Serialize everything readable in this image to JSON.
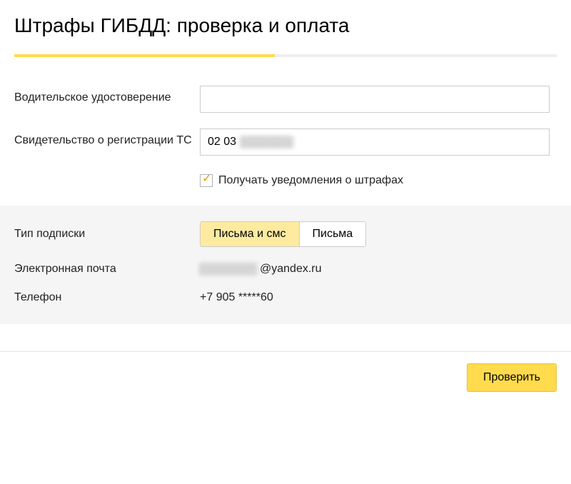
{
  "title": "Штрафы ГИБДД: проверка и оплата",
  "fields": {
    "driver_license": {
      "label": "Водительское удостоверение",
      "value": ""
    },
    "registration": {
      "label": "Свидетельство о регистрации ТС",
      "visible": "02 03"
    }
  },
  "notify": {
    "label": "Получать уведомления о штрафах",
    "checked": true
  },
  "subscription": {
    "type_label": "Тип подписки",
    "options": {
      "letters_sms": "Письма и смс",
      "letters": "Письма"
    },
    "email_label": "Электронная почта",
    "email_domain": "@yandex.ru",
    "phone_label": "Телефон",
    "phone_value": "+7 905 *****60"
  },
  "submit": "Проверить"
}
